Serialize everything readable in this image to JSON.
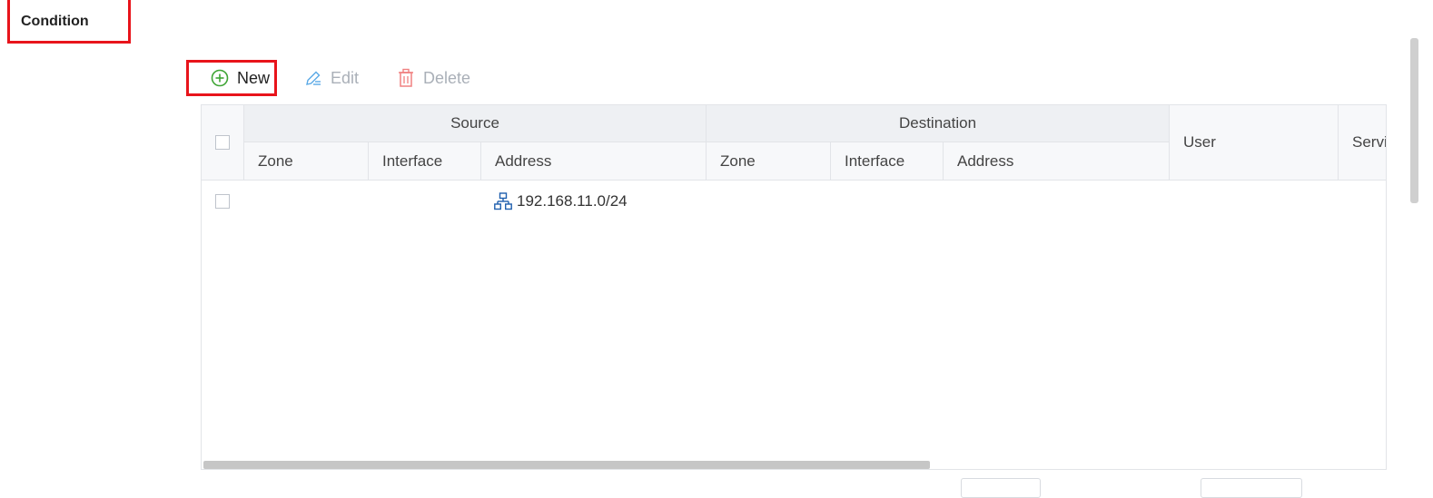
{
  "section": {
    "title": "Condition"
  },
  "toolbar": {
    "new_label": "New",
    "edit_label": "Edit",
    "delete_label": "Delete"
  },
  "table": {
    "group_headers": {
      "source": "Source",
      "destination": "Destination"
    },
    "source_columns": [
      "Zone",
      "Interface",
      "Address"
    ],
    "destination_columns": [
      "Zone",
      "Interface",
      "Address"
    ],
    "user": "User",
    "service": "Service",
    "rows": [
      {
        "source_zone": "",
        "source_interface": "",
        "source_address": "192.168.11.0/24",
        "source_address_icon": "network-icon"
      }
    ]
  },
  "colors": {
    "highlight": "#e8141b",
    "new_icon": "#3fa535",
    "edit_icon": "#5aa9e6",
    "delete_icon": "#f08080",
    "network_icon": "#1f5fae"
  }
}
